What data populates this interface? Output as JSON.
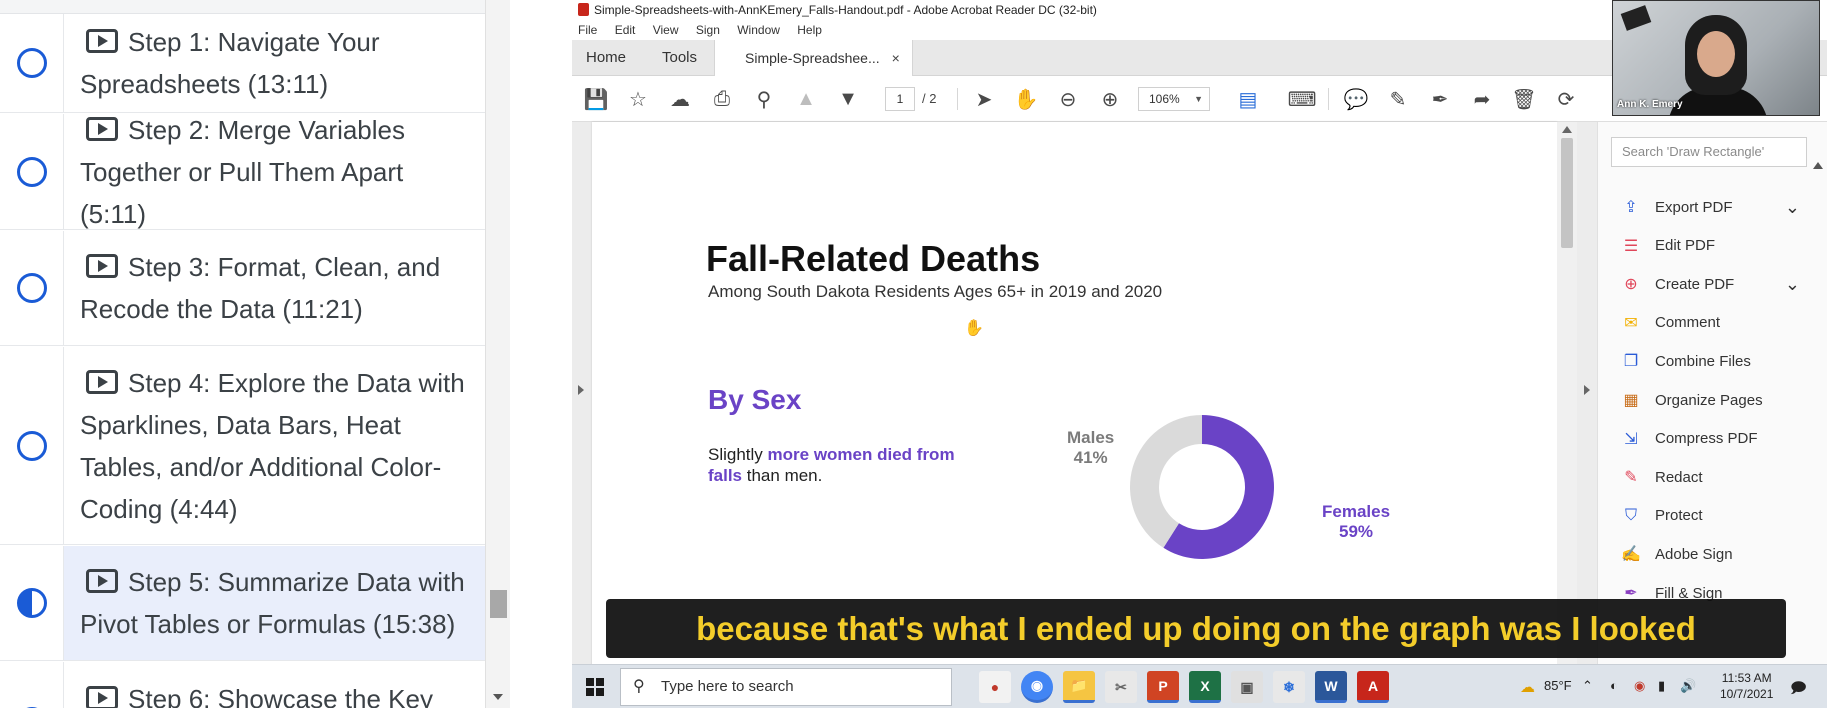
{
  "course_sidebar": {
    "lessons": [
      {
        "title": "Step 1: Navigate Your Spreadsheets (13:11)",
        "status": "not-started"
      },
      {
        "title": "Step 2: Merge Variables Together or Pull Them Apart (5:11)",
        "status": "not-started"
      },
      {
        "title": "Step 3: Format, Clean, and Recode the Data (11:21)",
        "status": "not-started"
      },
      {
        "title": "Step 4: Explore the Data with Sparklines, Data Bars, Heat Tables, and/or Additional Color-Coding (4:44)",
        "status": "not-started"
      },
      {
        "title": "Step 5: Summarize Data with Pivot Tables or Formulas (15:38)",
        "status": "in-progress"
      },
      {
        "title": "Step 6: Showcase the Key",
        "status": "not-started"
      }
    ]
  },
  "acrobat": {
    "window_title": "Simple-Spreadsheets-with-AnnKEmery_Falls-Handout.pdf - Adobe Acrobat Reader DC (32-bit)",
    "menu": [
      "File",
      "Edit",
      "View",
      "Sign",
      "Window",
      "Help"
    ],
    "tabs": {
      "home": "Home",
      "tools": "Tools",
      "document": "Simple-Spreadshee...",
      "close": "×"
    },
    "toolbar": {
      "page_current": "1",
      "page_total": "/ 2",
      "zoom": "106%"
    },
    "tools_pane": {
      "search_placeholder": "Search 'Draw Rectangle'",
      "items": [
        {
          "label": "Export PDF",
          "icon": "export-pdf-icon",
          "color": "#2a5bd7",
          "expandable": true
        },
        {
          "label": "Edit PDF",
          "icon": "edit-pdf-icon",
          "color": "#e0465a",
          "expandable": false
        },
        {
          "label": "Create PDF",
          "icon": "create-pdf-icon",
          "color": "#e0465a",
          "expandable": true
        },
        {
          "label": "Comment",
          "icon": "comment-icon",
          "color": "#f2b000",
          "expandable": false
        },
        {
          "label": "Combine Files",
          "icon": "combine-files-icon",
          "color": "#2a5bd7",
          "expandable": false
        },
        {
          "label": "Organize Pages",
          "icon": "organize-pages-icon",
          "color": "#c9701e",
          "expandable": false
        },
        {
          "label": "Compress PDF",
          "icon": "compress-pdf-icon",
          "color": "#2a5bd7",
          "expandable": false
        },
        {
          "label": "Redact",
          "icon": "redact-icon",
          "color": "#e0465a",
          "expandable": false
        },
        {
          "label": "Protect",
          "icon": "protect-icon",
          "color": "#2a5bd7",
          "expandable": false
        },
        {
          "label": "Adobe Sign",
          "icon": "adobe-sign-icon",
          "color": "#8a3fc0",
          "expandable": false
        },
        {
          "label": "Fill & Sign",
          "icon": "fill-sign-icon",
          "color": "#8a3fc0",
          "expandable": false
        }
      ]
    }
  },
  "document": {
    "title": "Fall-Related Deaths",
    "subtitle": "Among South Dakota Residents Ages 65+ in 2019 and 2020",
    "section_title": "By Sex",
    "description_prefix": "Slightly ",
    "description_bold": "more women died from falls",
    "description_suffix": " than men.",
    "chart_data": {
      "type": "pie",
      "title": "",
      "categories": [
        "Females",
        "Males"
      ],
      "values": [
        59,
        41
      ],
      "labels": [
        {
          "name": "Males",
          "value": "41%"
        },
        {
          "name": "Females",
          "value": "59%"
        }
      ],
      "colors": [
        "#6a43c6",
        "#dadada"
      ]
    }
  },
  "webcam": {
    "name": "Ann K. Emery"
  },
  "caption": "because that's what I ended up doing on the graph was I looked",
  "taskbar": {
    "search_placeholder": "Type here to search",
    "weather": "85°F",
    "time": "11:53 AM",
    "date": "10/7/2021"
  }
}
